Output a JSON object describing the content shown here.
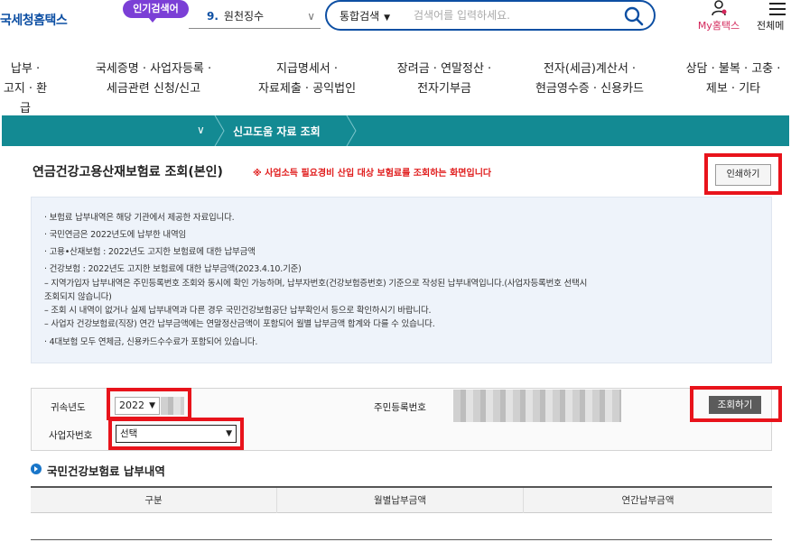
{
  "header": {
    "logo": "국세청홈택스",
    "hot_badge": "인기검색어",
    "rank_number": "9.",
    "rank_term": "원천징수",
    "search_scope": "통합검색",
    "search_placeholder": "검색어를 입력하세요.",
    "my_hometax": "My홈택스",
    "all_menu": "전체메"
  },
  "gnb": [
    "납부 ·\n고지 · 환급",
    "국세증명 · 사업자등록 ·\n세금관련 신청/신고",
    "지급명세서 ·\n자료제출 · 공익법인",
    "장려금 · 연말정산 ·\n전자기부금",
    "전자(세금)계산서 ·\n현금영수증 · 신용카드",
    "상담 · 불복 · 고충 ·\n제보 · 기타"
  ],
  "subnav": {
    "crumb": "신고도움 자료 조회"
  },
  "page": {
    "title": "연금건강고용산재보험료 조회(본인)",
    "note": "※ 사업소득 필요경비 산입 대상 보험료를 조회하는 화면입니다",
    "print_label": "인쇄하기"
  },
  "info": [
    "· 보험료 납부내역은 해당 기관에서 제공한 자료입니다.",
    "· 국민연금은 2022년도에 납부한 내역임",
    "· 고용•산재보험 :  2022년도 고지한 보험료에 대한 납부금액",
    "· 건강보험 : 2022년도 고지한 보험료에 대한 납부금액(2023.4.10.기준)",
    "  – 지역가입자 납부내역은 주민등록번호 조회와 동시에 확인 가능하며, 납부자번호(건강보험증번호) 기준으로 작성된 납부내역입니다.(사업자등록번호 선택시",
    "  조회되지 않습니다)",
    "  – 조회 시 내역이 없거나 실제 납부내역과 다른 경우 국민건강보험공단 납부확인서 등으로 확인하시기 바랍니다.",
    "  – 사업자 건강보험료(직장) 연간 납부금액에는 연말정산금액이 포함되어 월별 납부금액 합계와 다를 수 있습니다.",
    "· 4대보험 모두 연체금, 신용카드수수료가 포함되어 있습니다."
  ],
  "form": {
    "year_label": "귀속년도",
    "year_value": "2022",
    "rrn_label": "주민등록번호",
    "biz_label": "사업자번호",
    "biz_value": "선택",
    "query_label": "조회하기"
  },
  "section": {
    "title": "국민건강보험료 납부내역",
    "columns": [
      "구분",
      "월별납부금액",
      "연간납부금액"
    ]
  },
  "colors": {
    "brand": "#0d4fa3",
    "teal": "#138a93",
    "alert": "#e01b1b",
    "highlight": "#e8131b"
  }
}
